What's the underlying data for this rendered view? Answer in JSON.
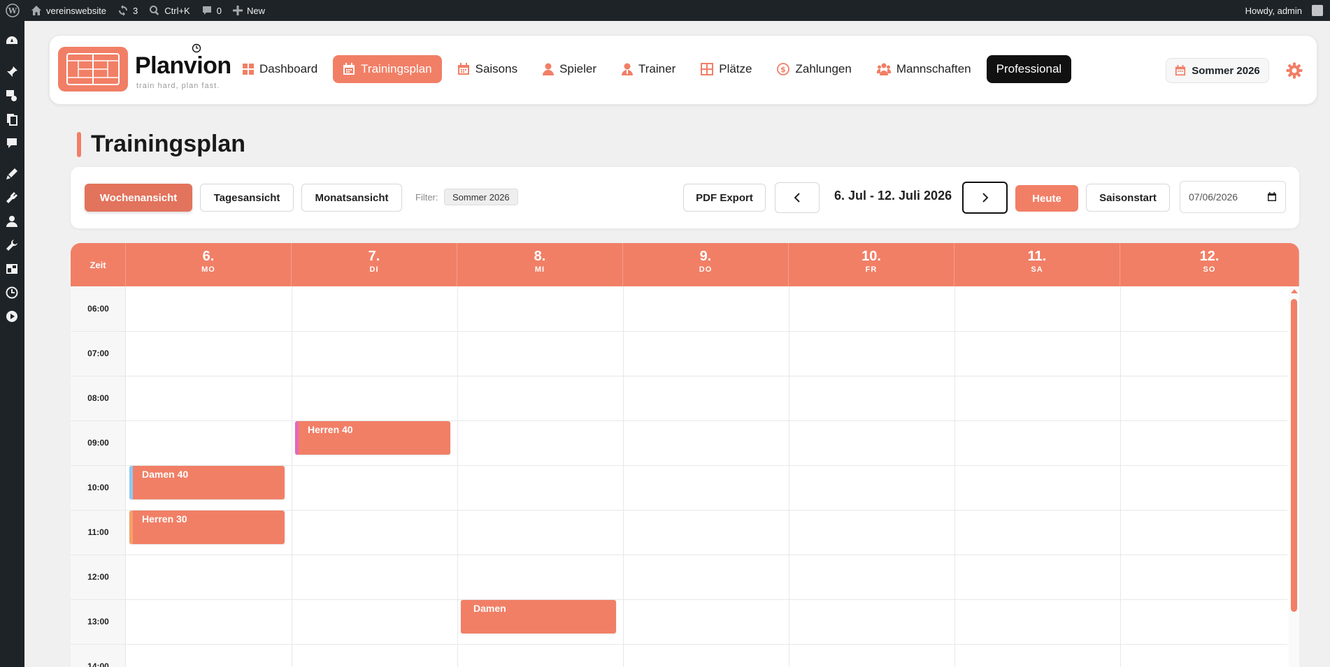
{
  "adminbar": {
    "site_name": "vereinswebsite",
    "updates_count": "3",
    "search_shortcut": "Ctrl+K",
    "comments_count": "0",
    "new_label": "New",
    "greeting": "Howdy, admin"
  },
  "sidemenu": {
    "icons": [
      "dashboard-icon",
      "pin-icon",
      "media-icon",
      "pages-icon",
      "comments-icon",
      "appearance-icon",
      "plugins-icon",
      "users-icon",
      "tools-icon",
      "settings-icon",
      "clock-icon",
      "play-icon"
    ]
  },
  "app": {
    "brand": "Planvion",
    "tagline": "train hard, plan fast.",
    "nav": [
      {
        "label": "Dashboard",
        "icon": "grid-icon"
      },
      {
        "label": "Trainingsplan",
        "icon": "calendar-icon"
      },
      {
        "label": "Saisons",
        "icon": "calendar-icon"
      },
      {
        "label": "Spieler",
        "icon": "person-icon"
      },
      {
        "label": "Trainer",
        "icon": "trainer-icon"
      },
      {
        "label": "Plätze",
        "icon": "court-icon"
      },
      {
        "label": "Zahlungen",
        "icon": "dollar-icon"
      },
      {
        "label": "Mannschaften",
        "icon": "team-icon"
      },
      {
        "label": "Professional",
        "icon": ""
      }
    ],
    "active_nav": "Trainingsplan",
    "season": "Sommer 2026",
    "accent": "#f17f66"
  },
  "page": {
    "title": "Trainingsplan"
  },
  "toolbar": {
    "views": [
      "Wochenansicht",
      "Tagesansicht",
      "Monatsansicht"
    ],
    "active_view": "Wochenansicht",
    "filter_label": "Filter:",
    "filter_value": "Sommer 2026",
    "pdf_export": "PDF Export",
    "range": "6. Jul - 12. Juli 2026",
    "today": "Heute",
    "season_start": "Saisonstart",
    "date_value": "07/06/2026"
  },
  "calendar": {
    "time_header": "Zeit",
    "days": [
      {
        "num": "6.",
        "name": "MO"
      },
      {
        "num": "7.",
        "name": "DI"
      },
      {
        "num": "8.",
        "name": "MI"
      },
      {
        "num": "9.",
        "name": "DO"
      },
      {
        "num": "10.",
        "name": "FR"
      },
      {
        "num": "11.",
        "name": "SA"
      },
      {
        "num": "12.",
        "name": "SO"
      }
    ],
    "times": [
      "06:00",
      "07:00",
      "08:00",
      "09:00",
      "10:00",
      "11:00",
      "12:00",
      "13:00",
      "14:00"
    ],
    "events": [
      {
        "title": "Herren 40",
        "day": "7.",
        "start": "09:00",
        "stripe": "#e667b8"
      },
      {
        "title": "Damen 40",
        "day": "6.",
        "start": "10:00",
        "stripe": "#8ec9f5"
      },
      {
        "title": "Herren 30",
        "day": "6.",
        "start": "11:00",
        "stripe": "#f5a06a"
      },
      {
        "title": "Damen",
        "day": "8.",
        "start": "13:00",
        "stripe": "#f17f66"
      }
    ]
  }
}
